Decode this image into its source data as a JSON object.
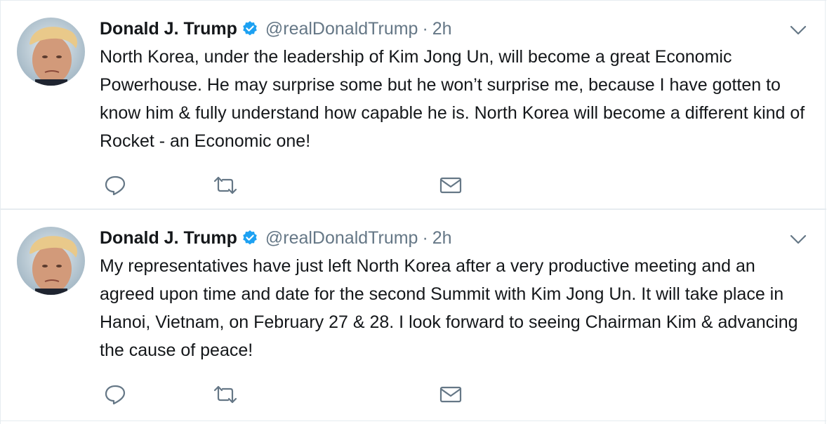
{
  "tweets": [
    {
      "name": "Donald J. Trump",
      "handle": "@realDonaldTrump",
      "separator": "·",
      "time": "2h",
      "text": "North Korea, under the leadership of Kim Jong Un, will become a great Economic Powerhouse. He may surprise some but he won’t surprise me, because I have gotten to know him & fully understand how capable he is. North Korea will become a different kind of Rocket - an Economic one!",
      "icons": [
        "avatar",
        "verified-badge-icon",
        "chevron-down-icon",
        "reply-icon",
        "retweet-icon",
        "direct-message-icon"
      ]
    },
    {
      "name": "Donald J. Trump",
      "handle": "@realDonaldTrump",
      "separator": "·",
      "time": "2h",
      "text": "My representatives have just left North Korea after a very productive meeting and an agreed upon time and date for the second Summit with Kim Jong Un. It will take place in Hanoi, Vietnam, on February 27 & 28. I look forward to seeing Chairman Kim & advancing the cause of peace!",
      "icons": [
        "avatar",
        "verified-badge-icon",
        "chevron-down-icon",
        "reply-icon",
        "retweet-icon",
        "direct-message-icon"
      ]
    }
  ],
  "colors": {
    "text": "#14171a",
    "secondary": "#657786",
    "verified": "#1da1f2",
    "divider": "#e6ecf0",
    "icon": "#657786"
  }
}
